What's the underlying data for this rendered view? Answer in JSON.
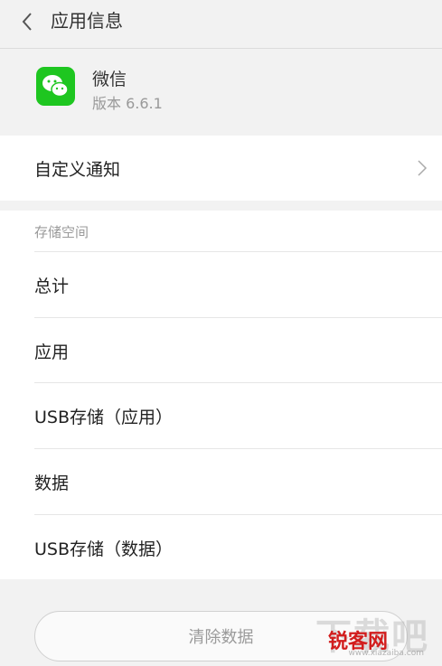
{
  "header": {
    "title": "应用信息"
  },
  "app": {
    "name": "微信",
    "version": "版本 6.6.1",
    "icon_color": "#1ec620"
  },
  "custom_notify": {
    "label": "自定义通知"
  },
  "storage": {
    "title": "存储空间",
    "rows": [
      {
        "label": "总计"
      },
      {
        "label": "应用"
      },
      {
        "label": "USB存储（应用）"
      },
      {
        "label": "数据"
      },
      {
        "label": "USB存储（数据）"
      }
    ]
  },
  "actions": {
    "clear_data": "清除数据"
  },
  "watermark": {
    "brand": "下载吧",
    "red_text": "锐客网",
    "url": "www.xiazaiba.com"
  }
}
